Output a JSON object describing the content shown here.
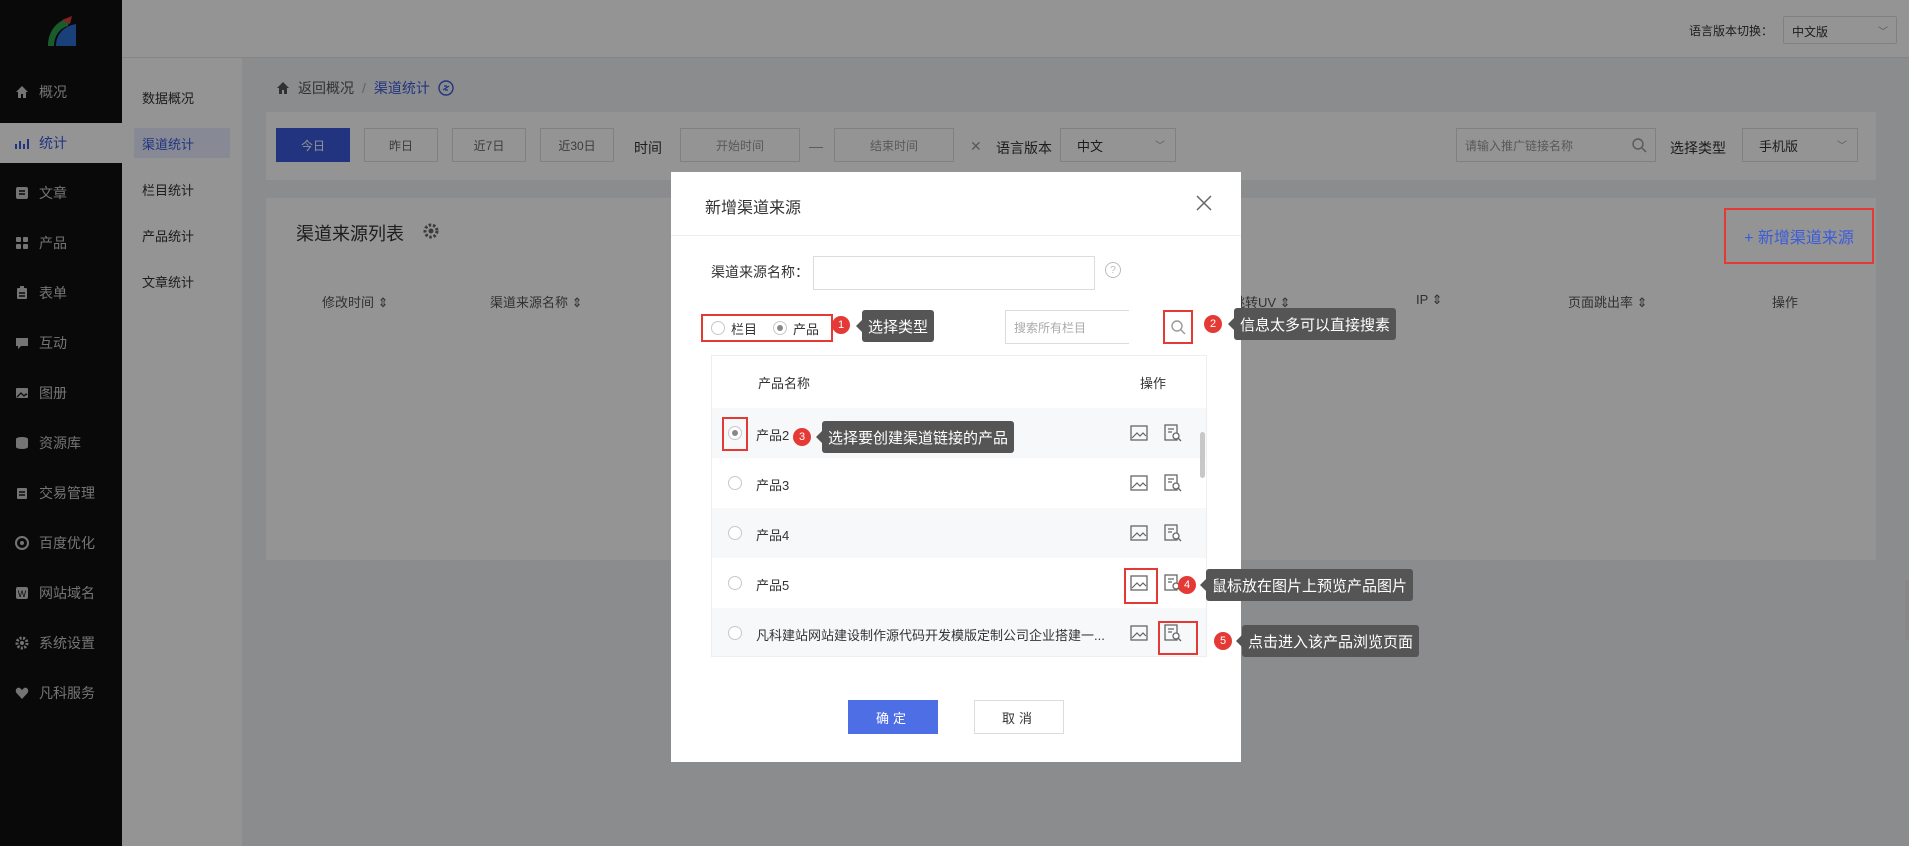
{
  "sidebar": {
    "items": [
      {
        "label": "概况",
        "icon": "home-icon"
      },
      {
        "label": "统计",
        "icon": "stats-icon"
      },
      {
        "label": "文章",
        "icon": "article-icon"
      },
      {
        "label": "产品",
        "icon": "product-icon"
      },
      {
        "label": "表单",
        "icon": "form-icon"
      },
      {
        "label": "互动",
        "icon": "chat-icon"
      },
      {
        "label": "图册",
        "icon": "gallery-icon"
      },
      {
        "label": "资源库",
        "icon": "database-icon"
      },
      {
        "label": "交易管理",
        "icon": "trade-icon"
      },
      {
        "label": "百度优化",
        "icon": "seo-icon"
      },
      {
        "label": "网站域名",
        "icon": "domain-icon"
      },
      {
        "label": "系统设置",
        "icon": "gear-icon"
      },
      {
        "label": "凡科服务",
        "icon": "heart-icon"
      }
    ]
  },
  "submenu": {
    "items": [
      "数据概况",
      "渠道统计",
      "栏目统计",
      "产品统计",
      "文章统计"
    ]
  },
  "header": {
    "lang_label": "语言版本切换：",
    "lang_value": "中文版"
  },
  "breadcrumb": {
    "back": "返回概况",
    "sep": "/",
    "current": "渠道统计"
  },
  "filters": {
    "today": "今日",
    "yesterday": "昨日",
    "last7": "近7日",
    "last30": "近30日",
    "time_label": "时间",
    "start_placeholder": "开始时间",
    "dash": "—",
    "end_placeholder": "结束时间",
    "lang_label": "语言版本",
    "lang_value": "中文",
    "search_placeholder": "请输入推广链接名称",
    "type_label": "选择类型",
    "type_value": "手机版"
  },
  "list": {
    "title": "渠道来源列表",
    "add_label": "+ 新增渠道来源",
    "columns": [
      "修改时间",
      "渠道来源名称",
      "跳转UV",
      "IP",
      "页面跳出率",
      "操作"
    ]
  },
  "modal": {
    "title": "新增渠道来源",
    "name_label": "渠道来源名称：",
    "help": "?",
    "type_options": [
      "栏目",
      "产品"
    ],
    "search_placeholder": "搜索所有栏目",
    "table_headers": [
      "产品名称",
      "操作"
    ],
    "rows": [
      {
        "name": "产品2",
        "selected": true
      },
      {
        "name": "产品3",
        "selected": false
      },
      {
        "name": "产品4",
        "selected": false
      },
      {
        "name": "产品5",
        "selected": false
      },
      {
        "name": "凡科建站网站建设制作源代码开发模版定制公司企业搭建一...",
        "selected": false
      }
    ],
    "ok": "确定",
    "cancel": "取消"
  },
  "annotations": [
    {
      "num": "1",
      "text": "选择类型"
    },
    {
      "num": "2",
      "text": "信息太多可以直接搜素"
    },
    {
      "num": "3",
      "text": "选择要创建渠道链接的产品"
    },
    {
      "num": "4",
      "text": "鼠标放在图片上预览产品图片"
    },
    {
      "num": "5",
      "text": "点击进入该产品浏览页面"
    }
  ],
  "colors": {
    "accent": "#3b5bdb",
    "highlight": "#e53935",
    "sidebar_bg": "#111111"
  }
}
